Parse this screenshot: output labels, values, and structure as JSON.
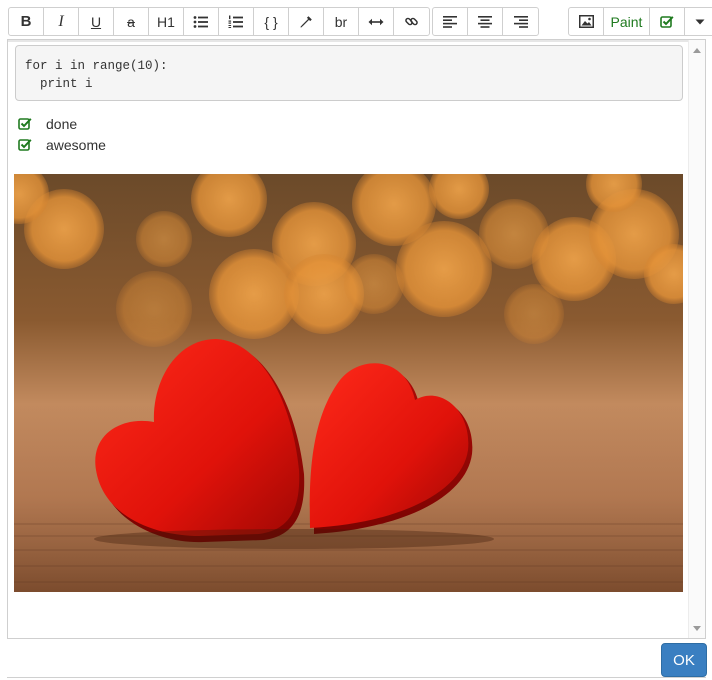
{
  "toolbar": {
    "bold": "B",
    "italic": "I",
    "underline": "U",
    "strike": "a",
    "heading": "H1",
    "code": "{ }",
    "linebreak": "br",
    "paint": "Paint",
    "icons": [
      "unordered-list-icon",
      "ordered-list-icon",
      "eyedropper-icon",
      "horizontal-rule-icon",
      "link-icon",
      "align-left-icon",
      "align-center-icon",
      "align-right-icon",
      "image-icon",
      "checkbox-icon",
      "caret-down-icon"
    ]
  },
  "editor": {
    "code": "for i in range(10):\n  print i",
    "tasks": [
      {
        "label": "done",
        "checked": true
      },
      {
        "label": "awesome",
        "checked": true
      }
    ]
  },
  "footer": {
    "ok_label": "OK"
  },
  "colors": {
    "accent": "#3a7fc1",
    "check": "#1f7a1f"
  }
}
